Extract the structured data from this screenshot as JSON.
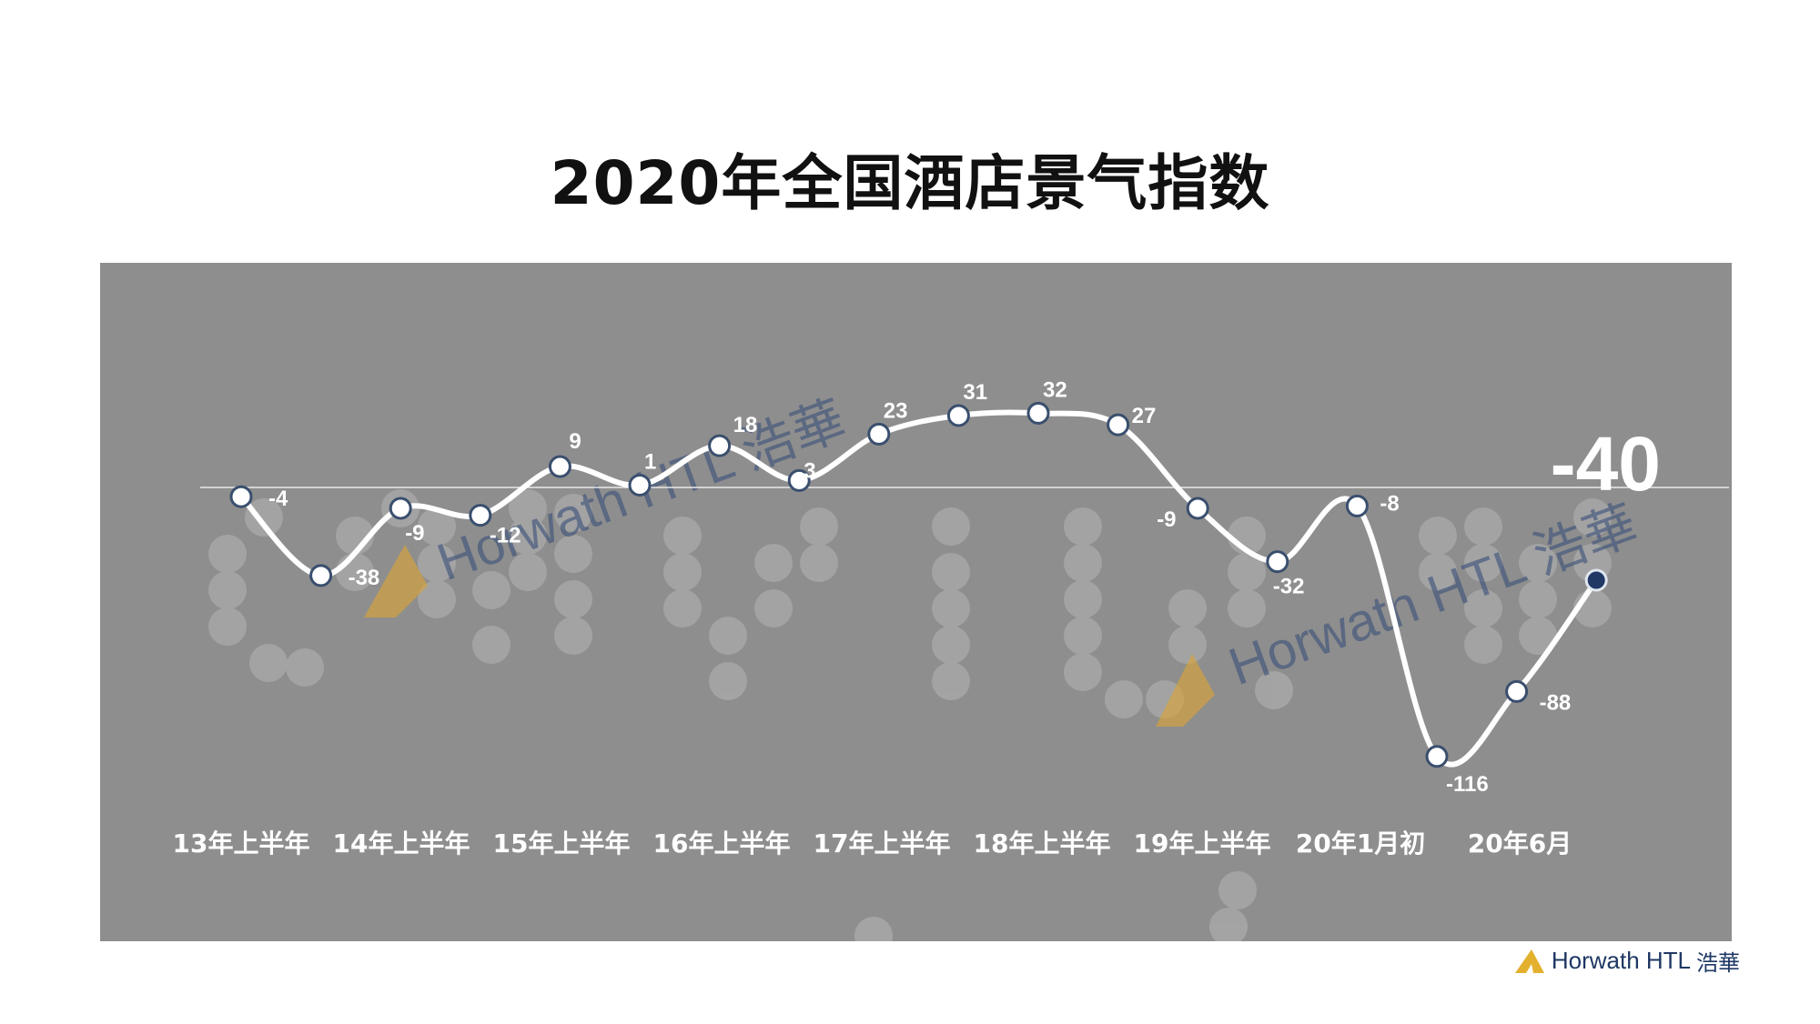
{
  "title": "2020年全国酒店景气指数",
  "watermark": {
    "text": "Horwath HTL 浩華"
  },
  "logo": {
    "brand": "Horwath HTL",
    "cn": "浩華"
  },
  "highlight": {
    "value": "-40"
  },
  "colors": {
    "panel": "#8e8e8e",
    "line": "#ffffff",
    "marker_fill": "#ffffff",
    "marker_stroke": "#3a4f6e",
    "highlight_marker": "#1f3864",
    "watermark": "#3a4f7a",
    "logo_gold": "#e3b12d"
  },
  "chart_data": {
    "type": "line",
    "title": "2020年全国酒店景气指数",
    "categories": [
      "13年上半年",
      "14年上半年",
      "15年上半年",
      "16年上半年",
      "17年上半年",
      "18年上半年",
      "19年上半年",
      "20年1月初",
      "20年6月"
    ],
    "series": [
      {
        "values": [
          -4,
          -38,
          -9,
          -12,
          9,
          1,
          18,
          3,
          23,
          31,
          32,
          27,
          -9,
          -32,
          -8,
          -116,
          -88,
          -40
        ],
        "labels": [
          "-4",
          "-38",
          "-9",
          "-12",
          "9",
          "1",
          "18",
          "3",
          "23",
          "31",
          "32",
          "27",
          "-9",
          "-32",
          "-8",
          "-116",
          "-88",
          ""
        ]
      }
    ],
    "ylim": [
      -140,
      60
    ],
    "baseline": 0,
    "grid": false,
    "legend": "none"
  }
}
